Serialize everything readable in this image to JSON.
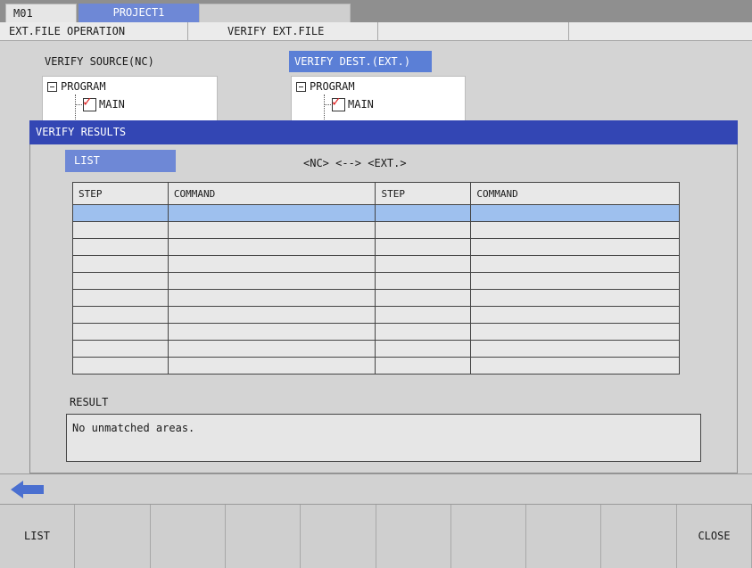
{
  "tabs": [
    "M01",
    "PROJECT1"
  ],
  "operation_bar": {
    "title": "EXT.FILE OPERATION",
    "mode": "VERIFY EXT.FILE"
  },
  "source_panel": {
    "label": "VERIFY SOURCE(NC)",
    "root": "PROGRAM",
    "item": "MAIN"
  },
  "dest_panel": {
    "label": "VERIFY DEST.(EXT.)",
    "root": "PROGRAM",
    "item": "MAIN"
  },
  "dialog": {
    "title": "VERIFY RESULTS",
    "list_tab": "LIST",
    "compare_label": "<NC> <--> <EXT.>",
    "columns": [
      "STEP",
      "COMMAND",
      "STEP",
      "COMMAND"
    ],
    "rows": [
      [
        "",
        "",
        "",
        ""
      ],
      [
        "",
        "",
        "",
        ""
      ],
      [
        "",
        "",
        "",
        ""
      ],
      [
        "",
        "",
        "",
        ""
      ],
      [
        "",
        "",
        "",
        ""
      ],
      [
        "",
        "",
        "",
        ""
      ],
      [
        "",
        "",
        "",
        ""
      ],
      [
        "",
        "",
        "",
        ""
      ],
      [
        "",
        "",
        "",
        ""
      ],
      [
        "",
        "",
        "",
        ""
      ]
    ],
    "result_label": "RESULT",
    "result_text": "No unmatched areas."
  },
  "function_keys": [
    "LIST",
    "",
    "",
    "",
    "",
    "",
    "",
    "",
    "",
    "CLOSE"
  ],
  "colors": {
    "accent_blue": "#6e88d6",
    "dialog_title": "#3346b4",
    "selected_row": "#9ec0ee",
    "check_red": "#e02020",
    "back_arrow": "#4a6fd0"
  }
}
